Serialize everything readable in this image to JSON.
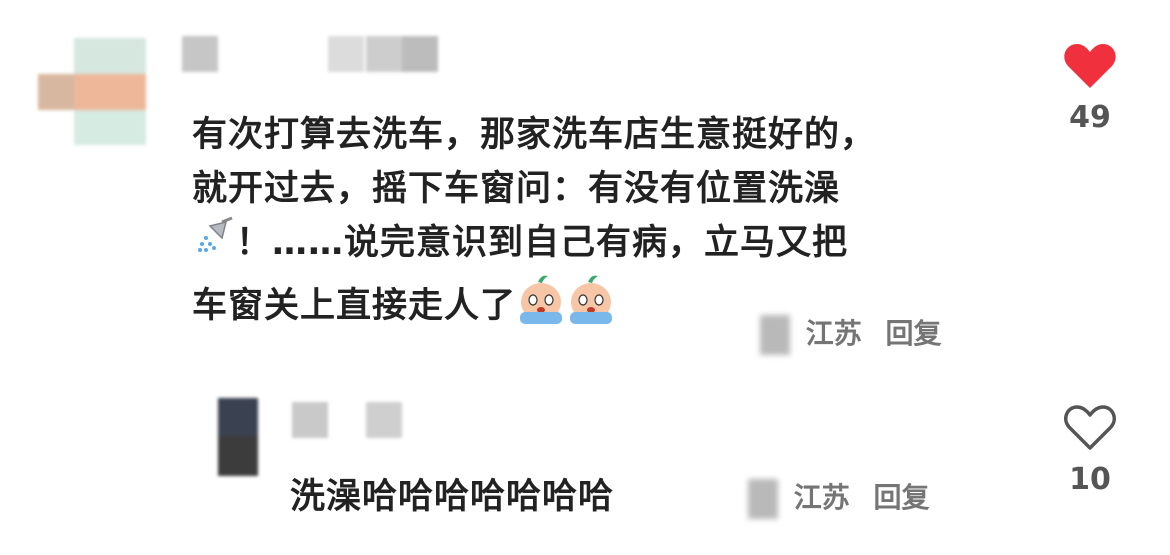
{
  "comment": {
    "lines": [
      "有次打算去洗车，那家洗车店生意挺好的，",
      "就开过去，摇下车窗问：有没有位置洗澡",
      "！……说完意识到自己有病，立马又把",
      "车窗关上直接走人了"
    ],
    "location": "江苏",
    "reply_label": "回复",
    "likes": "49",
    "liked": true,
    "emoji_inline": "shower-icon",
    "emoji_trailing": [
      "crying-face-icon",
      "crying-face-icon"
    ]
  },
  "reply": {
    "text": "洗澡哈哈哈哈哈哈哈",
    "location": "江苏",
    "reply_label": "回复",
    "likes": "10",
    "liked": false
  },
  "colors": {
    "heart_liked": "#f0303c",
    "heart_outline": "#555555",
    "meta_text": "#757575"
  }
}
